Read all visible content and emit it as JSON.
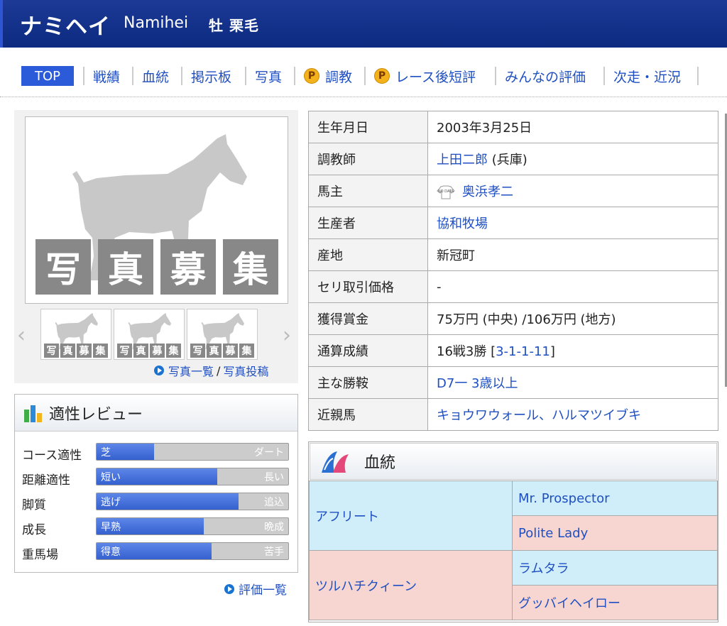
{
  "header": {
    "name_ja": "ナミヘイ",
    "name_en": "Namihei",
    "sex_color": "牡 栗毛"
  },
  "nav": {
    "items": [
      "TOP",
      "戦績",
      "血統",
      "掲示板",
      "写真",
      "調教",
      "レース後短評",
      "みんなの評価",
      "次走・近況"
    ],
    "premium_badge": "P"
  },
  "photo": {
    "placeholder_chars": [
      "写",
      "真",
      "募",
      "集"
    ],
    "list_link": "写真一覧",
    "separator": "/",
    "post_link": "写真投稿"
  },
  "review": {
    "title": "適性レビュー",
    "rows": [
      {
        "label": "コース適性",
        "left": "芝",
        "right": "ダート",
        "fraction": 0.3
      },
      {
        "label": "距離適性",
        "left": "短い",
        "right": "長い",
        "fraction": 0.63
      },
      {
        "label": "脚質",
        "left": "逃げ",
        "right": "追込",
        "fraction": 0.74
      },
      {
        "label": "成長",
        "left": "早熟",
        "right": "晩成",
        "fraction": 0.56
      },
      {
        "label": "重馬場",
        "left": "得意",
        "right": "苦手",
        "fraction": 0.6
      }
    ],
    "eval_link": "評価一覧"
  },
  "profile": {
    "rows": [
      {
        "key": "生年月日",
        "value": "2003年3月25日"
      },
      {
        "key": "調教師",
        "value": "上田二郎",
        "suffix": " (兵庫)",
        "link": true
      },
      {
        "key": "馬主",
        "value": "奥浜孝二",
        "link": true,
        "silk": "NO DATA"
      },
      {
        "key": "生産者",
        "value": "協和牧場",
        "link": true
      },
      {
        "key": "産地",
        "value": "新冠町"
      },
      {
        "key": "セリ取引価格",
        "value": "-"
      },
      {
        "key": "獲得賞金",
        "value": "75万円 (中央) /106万円 (地方)"
      },
      {
        "key": "通算成績",
        "value": "16戦3勝 [",
        "record": "3-1-1-11",
        "close": "]"
      },
      {
        "key": "主な勝鞍",
        "value": "D7一 3歳以上",
        "link": true
      },
      {
        "key": "近親馬",
        "value": "キョウワウォール、ハルマツイブキ",
        "link": true
      }
    ]
  },
  "pedigree": {
    "title": "血統",
    "sire": "アフリート",
    "sire_sire": "Mr. Prospector",
    "sire_dam": "Polite Lady",
    "dam": "ツルハチクィーン",
    "dam_sire": "ラムタラ",
    "dam_dam": "グッバイヘイロー"
  }
}
